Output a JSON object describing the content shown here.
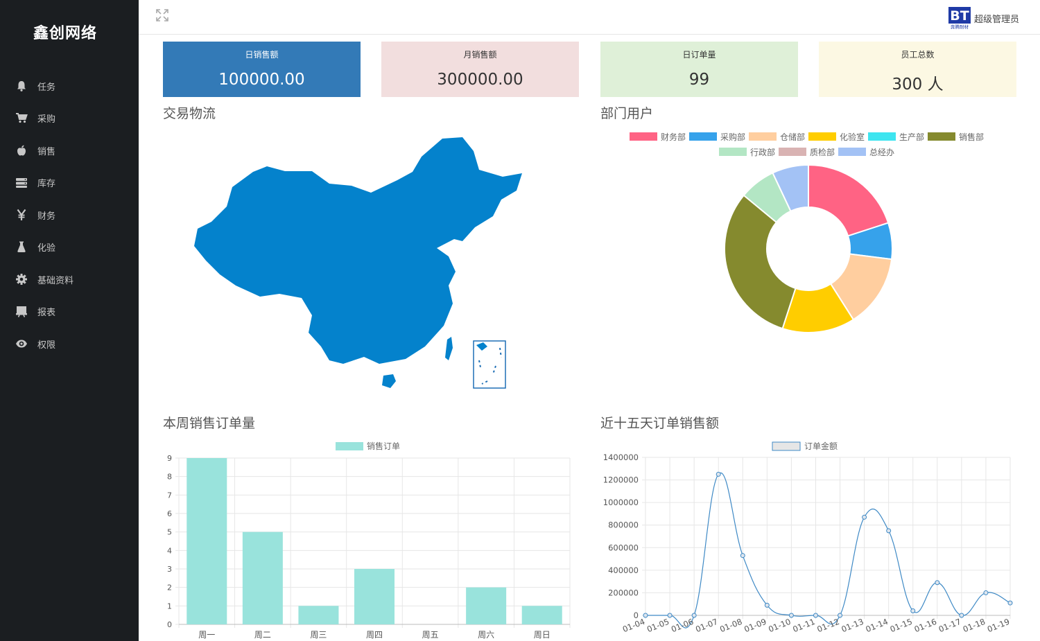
{
  "app": {
    "brand": "鑫创网络",
    "user_name": "超级管理员",
    "logo_text": "BT",
    "logo_subtext": "奔腾耐材"
  },
  "sidebar": {
    "items": [
      {
        "label": "任务",
        "icon": "bell-icon"
      },
      {
        "label": "采购",
        "icon": "cart-icon"
      },
      {
        "label": "销售",
        "icon": "apple-icon"
      },
      {
        "label": "库存",
        "icon": "storage-icon"
      },
      {
        "label": "财务",
        "icon": "yen-icon"
      },
      {
        "label": "化验",
        "icon": "flask-icon"
      },
      {
        "label": "基础资料",
        "icon": "gear-icon"
      },
      {
        "label": "报表",
        "icon": "report-icon"
      },
      {
        "label": "权限",
        "icon": "eye-icon"
      }
    ]
  },
  "cards": [
    {
      "title": "日销售额",
      "value": "100000.00",
      "bg": "#337ab7",
      "fg": "#ffffff"
    },
    {
      "title": "月销售额",
      "value": "300000.00",
      "bg": "#f2dede",
      "fg": "#333333"
    },
    {
      "title": "日订单量",
      "value": "99",
      "bg": "#dff0d8",
      "fg": "#333333"
    },
    {
      "title": "员工总数",
      "value": "300 人",
      "bg": "#fcf8e3",
      "fg": "#333333"
    }
  ],
  "sections": {
    "map": "交易物流",
    "dept": "部门用户",
    "weekly": "本周销售订单量",
    "fifteen": "近十五天订单销售额"
  },
  "map_color": "#0482cc",
  "chart_data": [
    {
      "type": "pie",
      "variant": "doughnut",
      "title": "部门用户",
      "legend_placement": "top",
      "labels": [
        "财务部",
        "采购部",
        "仓储部",
        "化验室",
        "生产部",
        "销售部",
        "行政部",
        "质检部",
        "总经办"
      ],
      "values": [
        20,
        7,
        14,
        14,
        0,
        31,
        7,
        0,
        7
      ],
      "colors": [
        "#ff6384",
        "#36a2eb",
        "#ffce9f",
        "#ffcd00",
        "#3ee5f0",
        "#858a2e",
        "#b3e6c4",
        "#d9b3b3",
        "#a3c2f5"
      ]
    },
    {
      "type": "bar",
      "title": "本周销售订单量",
      "legend_placement": "top",
      "grid": true,
      "categories": [
        "周一",
        "周二",
        "周三",
        "周四",
        "周五",
        "周六",
        "周日"
      ],
      "series": [
        {
          "name": "销售订单",
          "values": [
            9,
            5,
            1,
            3,
            0,
            2,
            1
          ],
          "color": "#99e3dc"
        }
      ],
      "ylim": [
        0,
        9
      ],
      "yticks": [
        0,
        1,
        2,
        3,
        4,
        5,
        6,
        7,
        8,
        9
      ]
    },
    {
      "type": "line",
      "title": "近十五天订单销售额",
      "legend_placement": "top",
      "grid": true,
      "x": [
        "01-04",
        "01-05",
        "01-06",
        "01-07",
        "01-08",
        "01-09",
        "01-10",
        "01-11",
        "01-12",
        "01-13",
        "01-14",
        "01-15",
        "01-16",
        "01-17",
        "01-18",
        "01-19"
      ],
      "series": [
        {
          "name": "订单金额",
          "values": [
            0,
            0,
            0,
            1250000,
            530000,
            90000,
            0,
            0,
            0,
            870000,
            750000,
            40000,
            290000,
            0,
            200000,
            110000
          ],
          "color": "#3e89c5",
          "fill": "#e6e6e6"
        }
      ],
      "ylim": [
        0,
        1400000
      ],
      "yticks": [
        0,
        200000,
        400000,
        600000,
        800000,
        1000000,
        1200000,
        1400000
      ]
    }
  ]
}
